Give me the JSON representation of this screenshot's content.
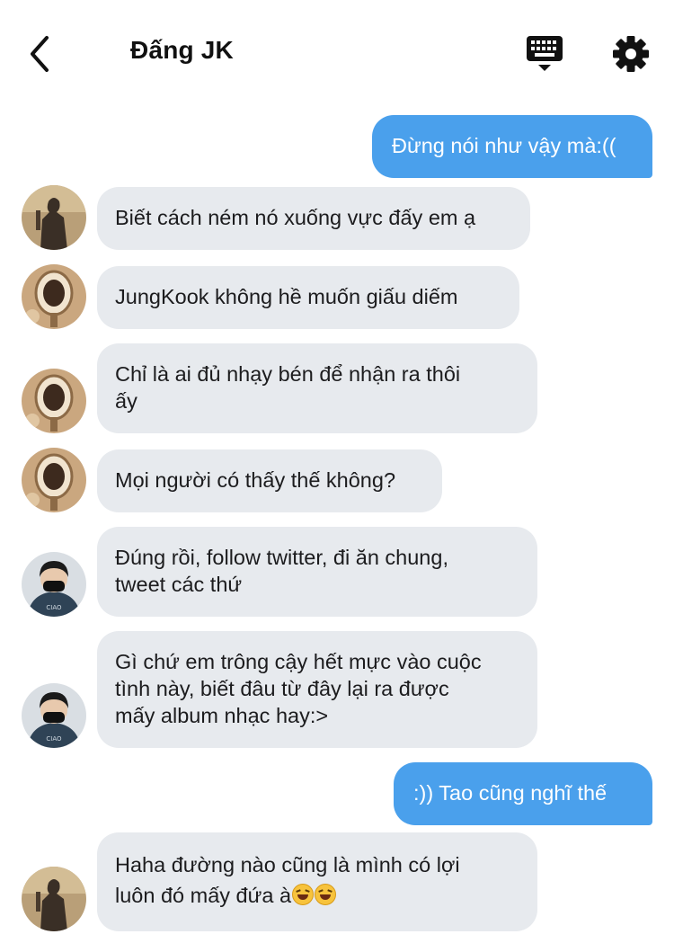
{
  "header": {
    "title": "Đấng JK",
    "icons": [
      "back-arrow-icon",
      "keyboard-icon",
      "gear-icon"
    ]
  },
  "messages": [
    {
      "id": "m1",
      "direction": "outgoing",
      "text": "Đừng nói như vậy mà:(("
    },
    {
      "id": "m2",
      "direction": "incoming",
      "avatar": "silhouette",
      "text": "Biết cách ném nó xuống vực đấy em ạ"
    },
    {
      "id": "m3",
      "direction": "incoming",
      "avatar": "mirror",
      "text": "JungKook không hề muốn giấu diếm"
    },
    {
      "id": "m4",
      "direction": "incoming",
      "avatar": "mirror",
      "text": "Chỉ là ai đủ nhạy bén để nhận ra thôi\nấy"
    },
    {
      "id": "m5",
      "direction": "incoming",
      "avatar": "mirror",
      "text": "Mọi người có thấy thế không?"
    },
    {
      "id": "m6",
      "direction": "incoming",
      "avatar": "masked-person",
      "text": "Đúng rồi, follow twitter, đi ăn chung,\ntweet các thứ"
    },
    {
      "id": "m7",
      "direction": "incoming",
      "avatar": "masked-person",
      "text": "Gì chứ em trông cậy hết mực vào cuộc\ntình này, biết đâu từ đây lại ra được\nmấy album nhạc hay:>"
    },
    {
      "id": "m8",
      "direction": "outgoing",
      "text": ":)) Tao cũng nghĩ thế"
    },
    {
      "id": "m9",
      "direction": "incoming",
      "avatar": "silhouette",
      "text": "Haha đường nào cũng là mình có lợi\nluôn đó mấy đứa à",
      "emojis": [
        "grinning-squinting-face",
        "grinning-squinting-face"
      ]
    }
  ],
  "colors": {
    "outgoing_bubble": "#4aa0ec",
    "incoming_bubble": "#e7eaee",
    "text": "#1c1c1e"
  }
}
